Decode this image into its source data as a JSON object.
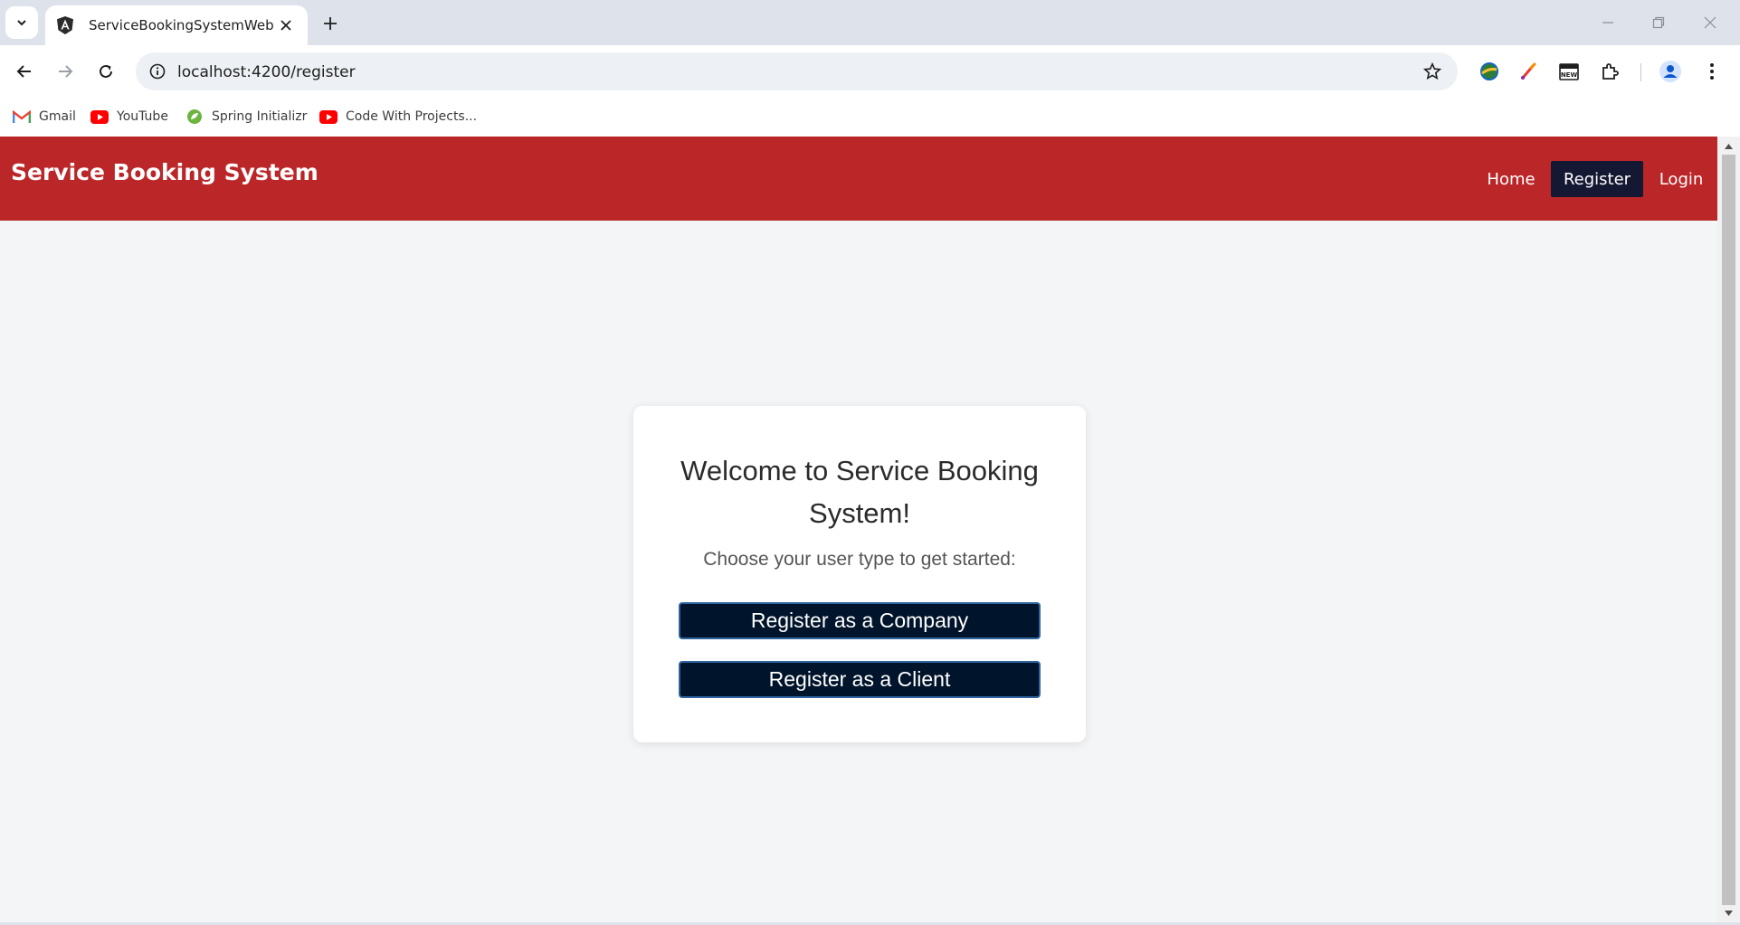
{
  "browser": {
    "tab_title": "ServiceBookingSystemWeb",
    "url": "localhost:4200/register",
    "bookmarks": [
      {
        "label": "Gmail",
        "icon": "gmail-icon"
      },
      {
        "label": "YouTube",
        "icon": "youtube-icon"
      },
      {
        "label": "Spring Initializr",
        "icon": "spring-icon"
      },
      {
        "label": "Code With Projects...",
        "icon": "youtube-icon"
      }
    ]
  },
  "navbar": {
    "brand": "Service Booking System",
    "links": [
      "Home",
      "Register",
      "Login"
    ],
    "active_link": "Register",
    "color": "#bb2629",
    "active_color": "#151833"
  },
  "card": {
    "title": "Welcome to Service Booking System!",
    "subtitle": "Choose your user type to get started:",
    "buttons": [
      "Register as a Company",
      "Register as a Client"
    ]
  }
}
